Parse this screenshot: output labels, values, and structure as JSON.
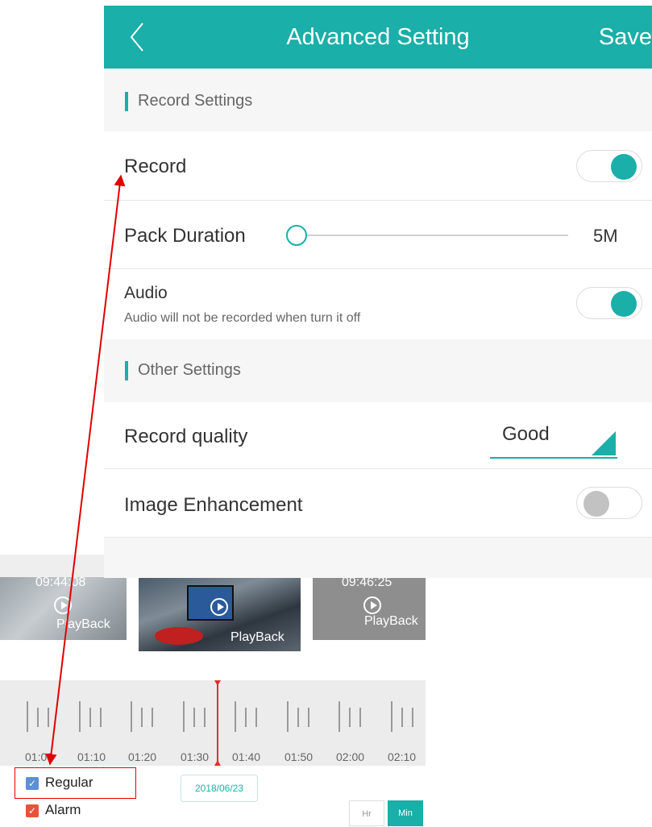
{
  "header": {
    "title": "Advanced Setting",
    "save_label": "Save",
    "back_icon": "chevron-left-icon"
  },
  "record_settings": {
    "title": "Record Settings",
    "record": {
      "label": "Record",
      "enabled": true
    },
    "pack_duration": {
      "label": "Pack Duration",
      "value": "5M",
      "slider_level": 0
    },
    "audio": {
      "label": "Audio",
      "description": "Audio will not be recorded when turn it off",
      "enabled": true
    }
  },
  "other_settings": {
    "title": "Other Settings",
    "record_quality": {
      "label": "Record quality",
      "value": "Good"
    },
    "image_enhancement": {
      "label": "Image Enhancement",
      "enabled": false
    }
  },
  "playback": {
    "thumbnails": [
      {
        "time": "09:44:08",
        "label": "PlayBack"
      },
      {
        "time": "",
        "label": "PlayBack"
      },
      {
        "time": "09:46:25",
        "label": "PlayBack"
      }
    ],
    "timeline": {
      "labels": [
        "01:00",
        "01:10",
        "01:20",
        "01:30",
        "01:40",
        "01:50",
        "02:00",
        "02:10"
      ]
    },
    "filters": [
      {
        "label": "Regular",
        "checked": true,
        "color": "#5b8fd6"
      },
      {
        "label": "Alarm",
        "checked": true,
        "color": "#e8523a"
      }
    ],
    "date": "2018/06/23",
    "scale_options": {
      "hr": "Hr",
      "min": "Min",
      "selected": "Min"
    }
  },
  "colors": {
    "accent": "#1aafa8",
    "annotation": "#e00000"
  }
}
